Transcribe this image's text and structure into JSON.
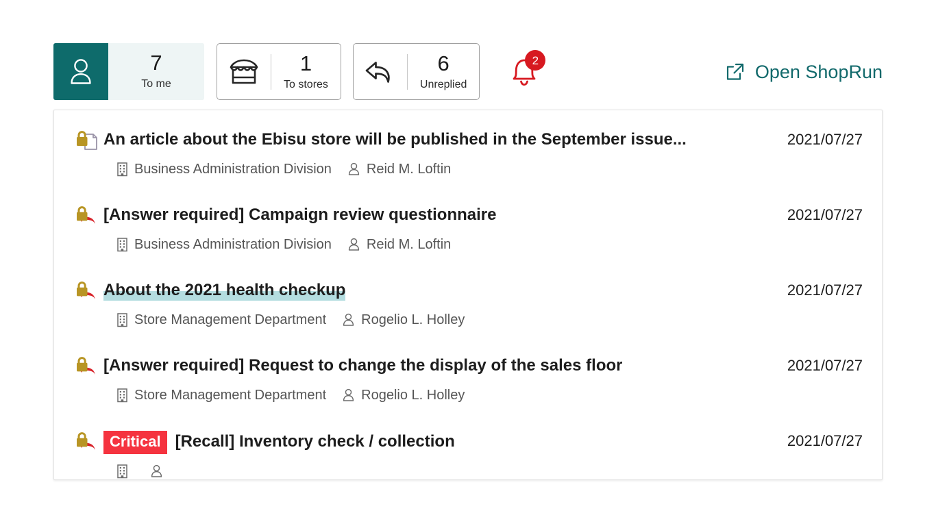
{
  "tabs": [
    {
      "icon": "person-icon",
      "count": "7",
      "label": "To me",
      "active": true
    },
    {
      "icon": "store-icon",
      "count": "1",
      "label": "To stores",
      "active": false
    },
    {
      "icon": "reply-icon",
      "count": "6",
      "label": "Unreplied",
      "active": false
    }
  ],
  "notifications": {
    "icon": "bell-icon",
    "badge_count": "2"
  },
  "open_link": {
    "icon": "external-link-icon",
    "label": "Open ShopRun"
  },
  "colors": {
    "accent_teal": "#0e6b6b",
    "link_teal": "#11696b",
    "active_tab_bg": "#eef5f5",
    "badge_red": "#f5333f",
    "bell_red": "#d71920",
    "lock_gold": "#b89524",
    "highlight_teal": "#b4dde0"
  },
  "messages": [
    {
      "status_icon": "lock-document-icon",
      "badge": "",
      "title": "An article about the Ebisu store will be published in the September issue...",
      "highlighted": false,
      "department": "Business Administration Division",
      "sender": "Reid M. Loftin",
      "date": "2021/07/27"
    },
    {
      "status_icon": "lock-reply-icon",
      "badge": "",
      "title": "[Answer required] Campaign review questionnaire",
      "highlighted": false,
      "department": "Business Administration Division",
      "sender": "Reid M. Loftin",
      "date": "2021/07/27"
    },
    {
      "status_icon": "lock-reply-icon",
      "badge": "",
      "title": "About the 2021 health checkup",
      "highlighted": true,
      "department": "Store Management Department",
      "sender": "Rogelio L. Holley",
      "date": "2021/07/27"
    },
    {
      "status_icon": "lock-reply-icon",
      "badge": "",
      "title": "[Answer required] Request to change the display of the sales floor",
      "highlighted": false,
      "department": "Store Management Department",
      "sender": "Rogelio L. Holley",
      "date": "2021/07/27"
    },
    {
      "status_icon": "lock-reply-icon",
      "badge": "Critical",
      "title": "[Recall] Inventory check / collection",
      "highlighted": false,
      "department": "",
      "sender": "",
      "date": "2021/07/27"
    }
  ],
  "meta_icons": {
    "department": "building-icon",
    "sender": "person-icon"
  }
}
